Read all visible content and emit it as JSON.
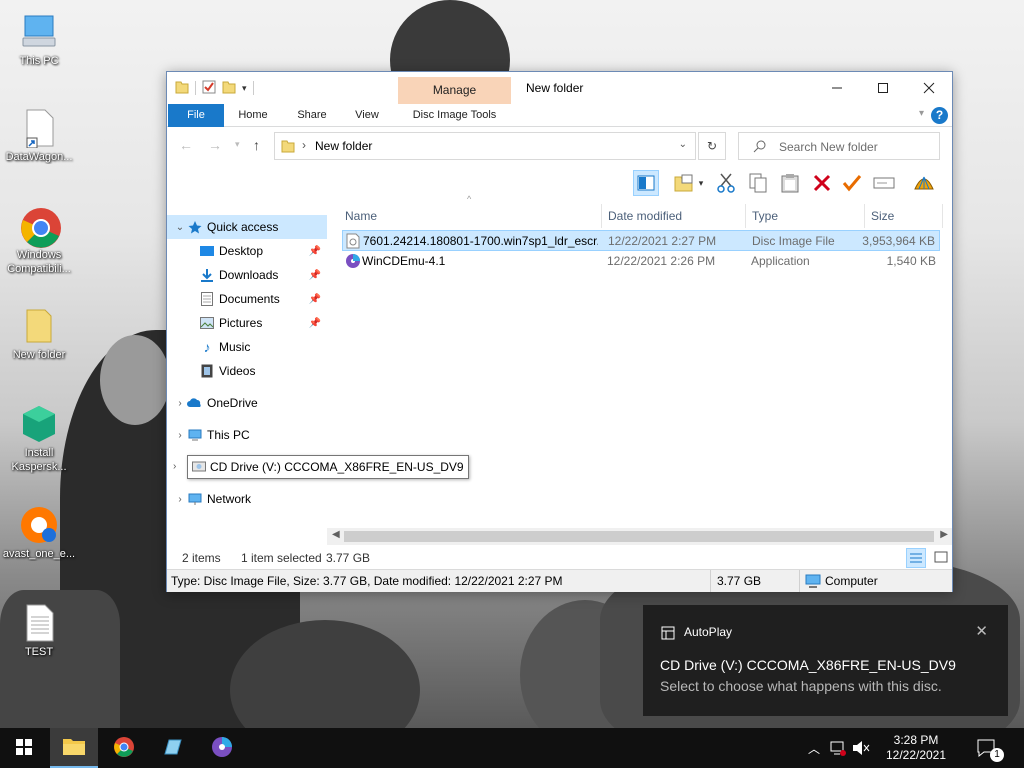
{
  "desktop": {
    "icons": [
      {
        "label": "This PC"
      },
      {
        "label": "DataWagon..."
      },
      {
        "label": "Windows Compatibili..."
      },
      {
        "label": "New folder"
      },
      {
        "label": "Install Kaspersk..."
      },
      {
        "label": "avast_one_e..."
      },
      {
        "label": "TEST"
      }
    ]
  },
  "window": {
    "title": "New folder",
    "manage_tab": "Manage",
    "ribbon_tabs": [
      "File",
      "Home",
      "Share",
      "View",
      "Disc Image Tools"
    ],
    "address": "New folder",
    "search_placeholder": "Search New folder",
    "columns": [
      "Name",
      "Date modified",
      "Type",
      "Size"
    ],
    "files": [
      {
        "name": "7601.24214.180801-1700.win7sp1_ldr_escr...",
        "date": "12/22/2021 2:27 PM",
        "type": "Disc Image File",
        "size": "3,953,964 KB",
        "selected": true
      },
      {
        "name": "WinCDEmu-4.1",
        "date": "12/22/2021 2:26 PM",
        "type": "Application",
        "size": "1,540 KB",
        "selected": false
      }
    ],
    "nav": {
      "quick_access": "Quick access",
      "pinned": [
        "Desktop",
        "Downloads",
        "Documents",
        "Pictures"
      ],
      "unpinned": [
        "Music",
        "Videos"
      ],
      "onedrive": "OneDrive",
      "this_pc": "This PC",
      "cd_drive": "CD Drive (V:) CCCOMA_X86FRE_EN-US_DV9",
      "network": "Network"
    },
    "status": {
      "items": "2 items",
      "selected": "1 item selected",
      "selected_size": "3.77 GB",
      "details": "Type: Disc Image File, Size: 3.77 GB, Date modified: 12/22/2021 2:27 PM",
      "size": "3.77 GB",
      "location": "Computer"
    }
  },
  "toast": {
    "app": "AutoPlay",
    "title": "CD Drive (V:) CCCOMA_X86FRE_EN-US_DV9",
    "body": "Select to choose what happens with this disc."
  },
  "taskbar": {
    "time": "3:28 PM",
    "date": "12/22/2021",
    "notification_count": "1"
  },
  "colors": {
    "accent": "#1979ca",
    "selection": "#cce8ff",
    "manage_tab": "#f9d4b8"
  }
}
